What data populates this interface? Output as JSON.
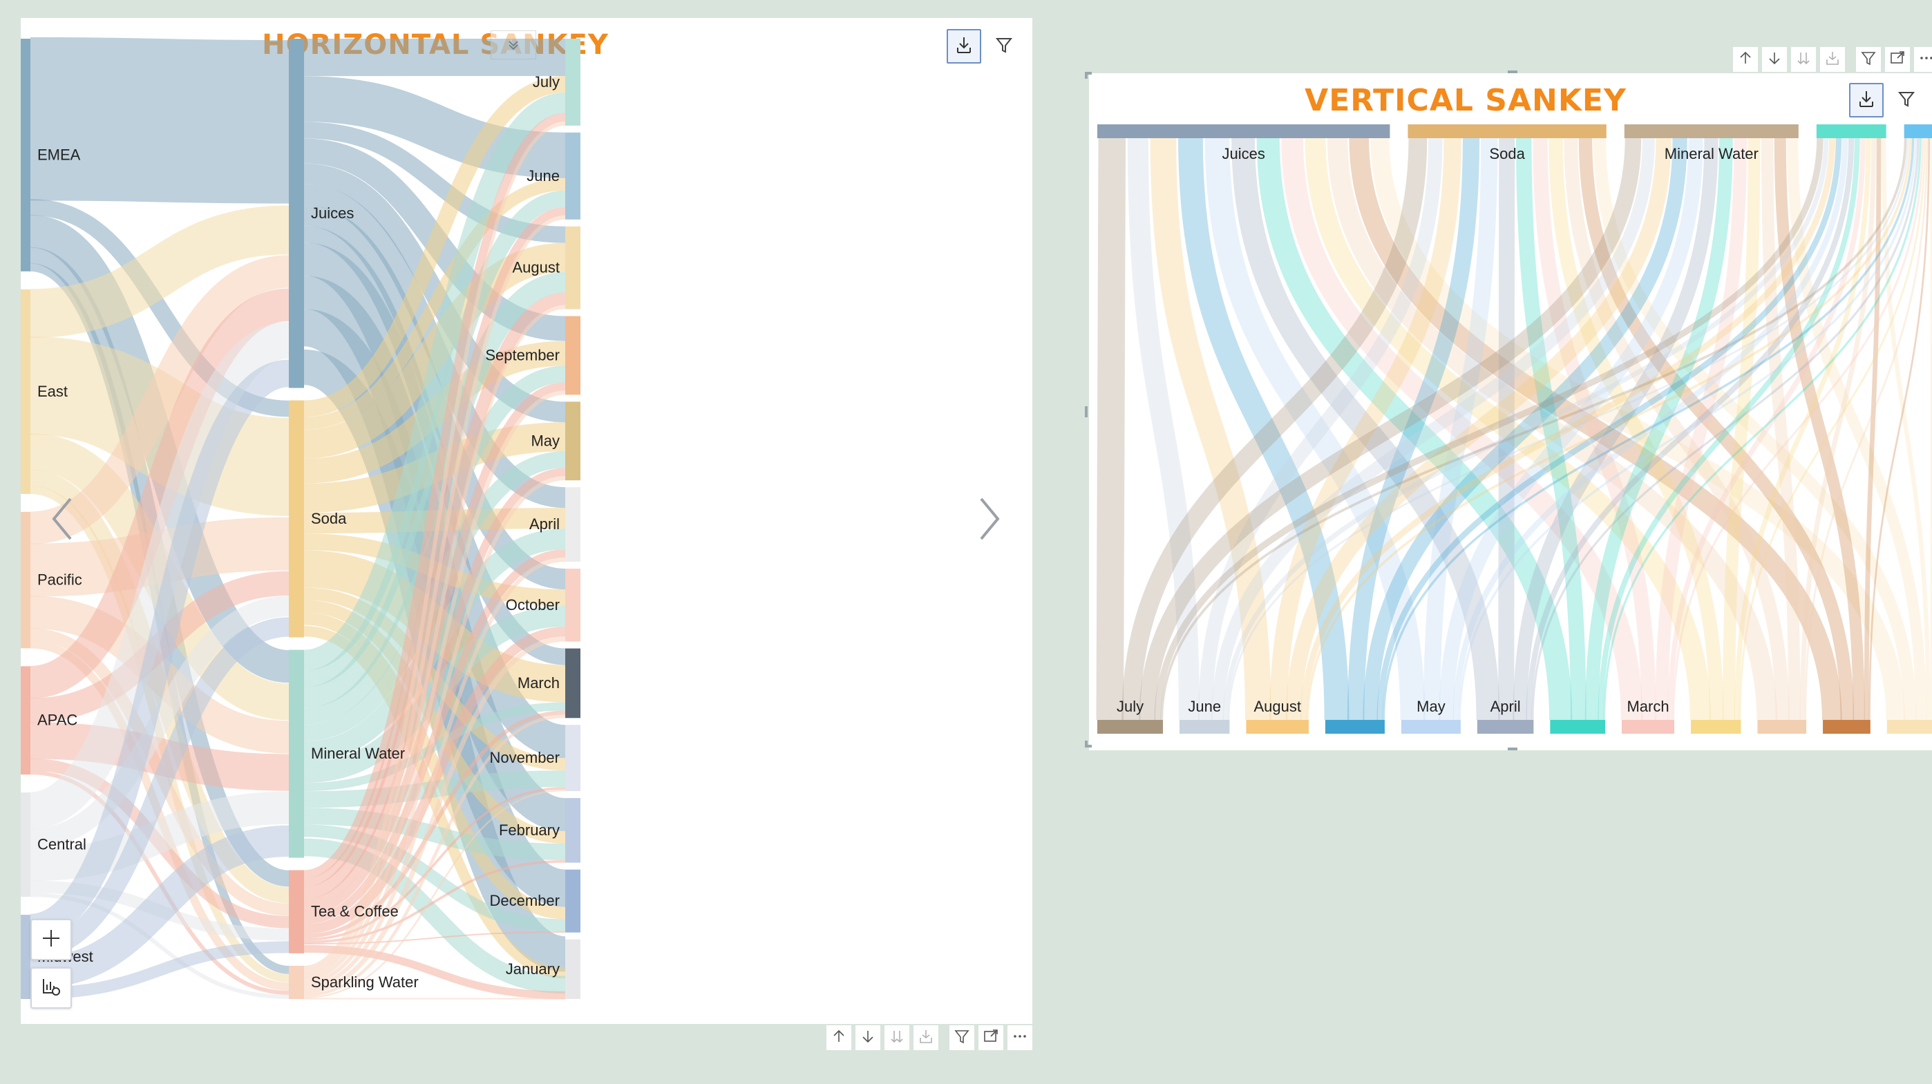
{
  "horizontal": {
    "title": "HORIZONTAL SANKEY",
    "sources": [
      {
        "label": "EMEA",
        "color": "#86aac0",
        "value": 290
      },
      {
        "label": "East",
        "color": "#f3dca9",
        "value": 255
      },
      {
        "label": "Pacific",
        "color": "#f5cfb4",
        "value": 170
      },
      {
        "label": "APAC",
        "color": "#f2b5a6",
        "value": 135
      },
      {
        "label": "Central",
        "color": "#e6e8ea",
        "value": 130
      },
      {
        "label": "Midwest",
        "color": "#b6c7dd",
        "value": 105
      }
    ],
    "middles": [
      {
        "label": "Juices",
        "color": "#86aac0",
        "value": 420
      },
      {
        "label": "Soda",
        "color": "#f1cf8a",
        "value": 285
      },
      {
        "label": "Mineral Water",
        "color": "#a9d8cf",
        "value": 250
      },
      {
        "label": "Tea & Coffee",
        "color": "#f2b0a0",
        "value": 100
      },
      {
        "label": "Sparkling Water",
        "color": "#f7d2bc",
        "value": 40
      }
    ],
    "targets": [
      {
        "label": "July",
        "color": "#b6e0d8",
        "value": 105
      },
      {
        "label": "June",
        "color": "#a6c6da",
        "value": 105
      },
      {
        "label": "August",
        "color": "#f2dcae",
        "value": 100
      },
      {
        "label": "September",
        "color": "#f2b88e",
        "value": 95
      },
      {
        "label": "May",
        "color": "#d8bf86",
        "value": 95
      },
      {
        "label": "April",
        "color": "#ececec",
        "value": 90
      },
      {
        "label": "October",
        "color": "#f8d0c4",
        "value": 88
      },
      {
        "label": "March",
        "color": "#5a6672",
        "value": 84
      },
      {
        "label": "November",
        "color": "#dfe4ee",
        "value": 80
      },
      {
        "label": "February",
        "color": "#bccbe1",
        "value": 78
      },
      {
        "label": "December",
        "color": "#9db6d8",
        "value": 76
      },
      {
        "label": "January",
        "color": "#e7e7ea",
        "value": 72
      }
    ],
    "links_source_middle": [
      [
        0,
        0,
        200
      ],
      [
        0,
        1,
        20
      ],
      [
        0,
        2,
        40
      ],
      [
        0,
        3,
        20
      ],
      [
        0,
        4,
        10
      ],
      [
        1,
        0,
        60
      ],
      [
        1,
        1,
        120
      ],
      [
        1,
        2,
        45
      ],
      [
        1,
        3,
        20
      ],
      [
        1,
        4,
        10
      ],
      [
        2,
        0,
        40
      ],
      [
        2,
        1,
        65
      ],
      [
        2,
        2,
        40
      ],
      [
        2,
        3,
        15
      ],
      [
        2,
        4,
        10
      ],
      [
        3,
        0,
        40
      ],
      [
        3,
        1,
        30
      ],
      [
        3,
        2,
        45
      ],
      [
        3,
        3,
        15
      ],
      [
        3,
        4,
        5
      ],
      [
        4,
        0,
        45
      ],
      [
        4,
        1,
        25
      ],
      [
        4,
        2,
        40
      ],
      [
        4,
        3,
        15
      ],
      [
        4,
        4,
        5
      ],
      [
        5,
        0,
        35
      ],
      [
        5,
        1,
        25
      ],
      [
        5,
        2,
        40
      ],
      [
        5,
        3,
        15
      ],
      [
        5,
        4,
        0
      ]
    ],
    "links_middle_target": [
      [
        0,
        0,
        45
      ],
      [
        0,
        1,
        55
      ],
      [
        0,
        2,
        20
      ],
      [
        0,
        3,
        30
      ],
      [
        0,
        4,
        25
      ],
      [
        0,
        5,
        25
      ],
      [
        0,
        6,
        25
      ],
      [
        0,
        7,
        20
      ],
      [
        0,
        8,
        40
      ],
      [
        0,
        9,
        40
      ],
      [
        0,
        10,
        45
      ],
      [
        0,
        11,
        50
      ],
      [
        1,
        0,
        20
      ],
      [
        1,
        1,
        15
      ],
      [
        1,
        2,
        35
      ],
      [
        1,
        3,
        30
      ],
      [
        1,
        4,
        35
      ],
      [
        1,
        5,
        25
      ],
      [
        1,
        6,
        20
      ],
      [
        1,
        7,
        45
      ],
      [
        1,
        8,
        15
      ],
      [
        1,
        9,
        15
      ],
      [
        1,
        10,
        15
      ],
      [
        1,
        11,
        15
      ],
      [
        2,
        0,
        25
      ],
      [
        2,
        1,
        20
      ],
      [
        2,
        2,
        25
      ],
      [
        2,
        3,
        20
      ],
      [
        2,
        4,
        20
      ],
      [
        2,
        5,
        25
      ],
      [
        2,
        6,
        25
      ],
      [
        2,
        7,
        10
      ],
      [
        2,
        8,
        20
      ],
      [
        2,
        9,
        20
      ],
      [
        2,
        10,
        15
      ],
      [
        2,
        11,
        25
      ],
      [
        3,
        0,
        10
      ],
      [
        3,
        1,
        10
      ],
      [
        3,
        2,
        15
      ],
      [
        3,
        3,
        10
      ],
      [
        3,
        4,
        10
      ],
      [
        3,
        5,
        10
      ],
      [
        3,
        6,
        12
      ],
      [
        3,
        7,
        5
      ],
      [
        3,
        8,
        3
      ],
      [
        3,
        9,
        3
      ],
      [
        3,
        10,
        1
      ],
      [
        3,
        11,
        11
      ],
      [
        4,
        0,
        5
      ],
      [
        4,
        1,
        5
      ],
      [
        4,
        2,
        5
      ],
      [
        4,
        3,
        5
      ],
      [
        4,
        4,
        5
      ],
      [
        4,
        5,
        5
      ],
      [
        4,
        6,
        6
      ],
      [
        4,
        7,
        4
      ],
      [
        4,
        8,
        2
      ],
      [
        4,
        9,
        0
      ],
      [
        4,
        10,
        0
      ],
      [
        4,
        11,
        1
      ]
    ]
  },
  "vertical": {
    "title": "VERTICAL SANKEY",
    "top": [
      {
        "label": "Juices",
        "color": "#8d9fb4",
        "value": 420
      },
      {
        "label": "Soda",
        "color": "#e1b472",
        "value": 285
      },
      {
        "label": "Mineral Water",
        "color": "#c3ad90",
        "value": 250
      },
      {
        "label": "",
        "color": "#5fe0cc",
        "value": 100
      },
      {
        "label": "",
        "color": "#69c3f0",
        "value": 40
      }
    ],
    "bottom": [
      {
        "label": "July",
        "color": "#a8957e",
        "value": 105
      },
      {
        "label": "June",
        "color": "#c8d3df",
        "value": 80
      },
      {
        "label": "August",
        "color": "#f7c97c",
        "value": 100
      },
      {
        "label": "",
        "color": "#3ea3d0",
        "value": 95
      },
      {
        "label": "May",
        "color": "#bcd6f3",
        "value": 95
      },
      {
        "label": "April",
        "color": "#9facc2",
        "value": 90
      },
      {
        "label": "",
        "color": "#3dd6c4",
        "value": 88
      },
      {
        "label": "March",
        "color": "#f8c7bf",
        "value": 84
      },
      {
        "label": "",
        "color": "#f7d98a",
        "value": 80
      },
      {
        "label": "",
        "color": "#f2cfb0",
        "value": 78
      },
      {
        "label": "",
        "color": "#c97f45",
        "value": 76
      },
      {
        "label": "",
        "color": "#f9e3b6",
        "value": 72
      }
    ]
  }
}
